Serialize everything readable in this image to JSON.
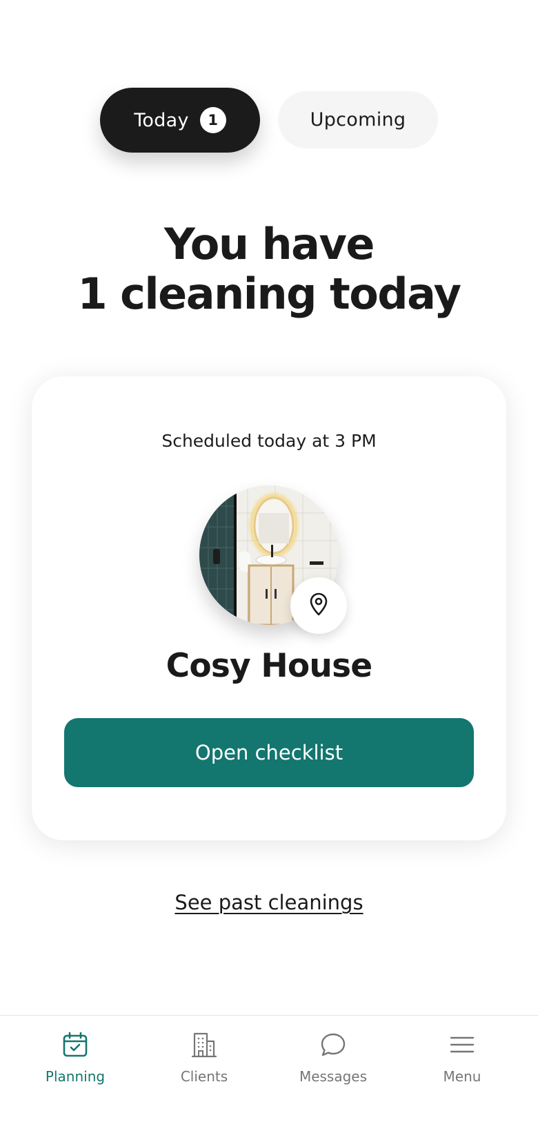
{
  "tabs": {
    "today_label": "Today",
    "today_count": "1",
    "upcoming_label": "Upcoming"
  },
  "headline": {
    "line1": "You have",
    "line2": "1 cleaning today"
  },
  "card": {
    "schedule": "Scheduled today at 3 PM",
    "property_name": "Cosy House",
    "primary_button": "Open checklist",
    "photo_icon": "bathroom-photo",
    "location_icon": "map-pin-icon"
  },
  "past_link": "See past cleanings",
  "nav": {
    "items": [
      {
        "label": "Planning",
        "icon": "calendar-check-icon",
        "active": true
      },
      {
        "label": "Clients",
        "icon": "building-icon",
        "active": false
      },
      {
        "label": "Messages",
        "icon": "chat-bubble-icon",
        "active": false
      },
      {
        "label": "Menu",
        "icon": "hamburger-menu-icon",
        "active": false
      }
    ]
  },
  "colors": {
    "accent": "#13766f",
    "dark_tab": "#1b1b1b",
    "inactive_tab": "#f5f5f5",
    "nav_inactive": "#757575"
  }
}
